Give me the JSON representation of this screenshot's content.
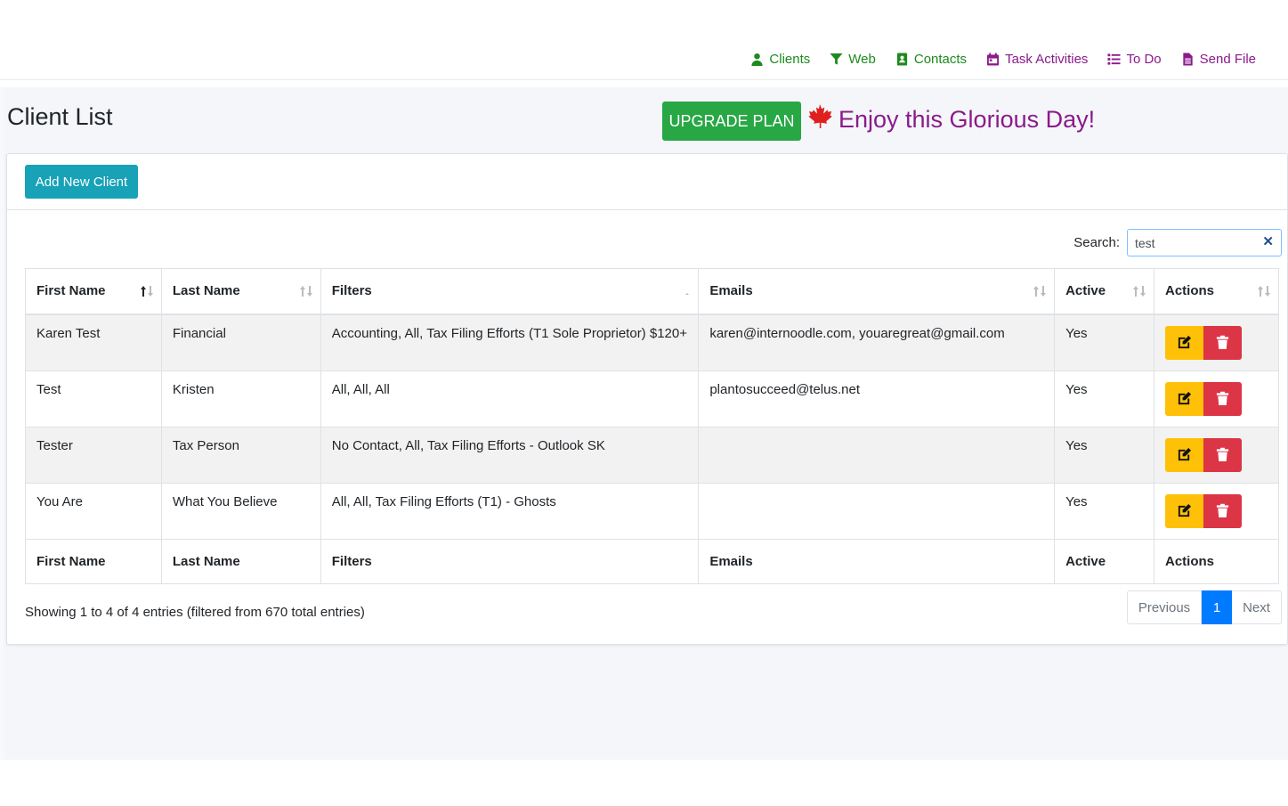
{
  "nav": {
    "items": [
      {
        "label": "Clients",
        "icon": "user-icon",
        "color": "green"
      },
      {
        "label": "Web",
        "icon": "filter-icon",
        "color": "green"
      },
      {
        "label": "Contacts",
        "icon": "address-book-icon",
        "color": "green"
      },
      {
        "label": "Task Activities",
        "icon": "calendar-icon",
        "color": "purple"
      },
      {
        "label": "To Do",
        "icon": "list-icon",
        "color": "purple"
      },
      {
        "label": "Send File",
        "icon": "file-icon",
        "color": "purple"
      }
    ]
  },
  "header": {
    "title": "Client List",
    "upgrade_label": "UPGRADE PLAN",
    "greeting": "Enjoy this Glorious Day!"
  },
  "card": {
    "add_label": "Add New Client",
    "search_label": "Search:",
    "search_value": "test",
    "search_clear": "✕"
  },
  "table": {
    "columns": [
      "First Name",
      "Last Name",
      "Filters",
      "Emails",
      "Active",
      "Actions"
    ],
    "rows": [
      {
        "first": "Karen Test",
        "last": "Financial",
        "filters": "Accounting, All, Tax Filing Efforts (T1 Sole Proprietor) $120+",
        "emails": "karen@internoodle.com, youaregreat@gmail.com",
        "active": "Yes"
      },
      {
        "first": "Test",
        "last": "Kristen",
        "filters": "All, All, All",
        "emails": "plantosucceed@telus.net",
        "active": "Yes"
      },
      {
        "first": "Tester",
        "last": "Tax Person",
        "filters": "No Contact, All, Tax Filing Efforts - Outlook SK",
        "emails": "",
        "active": "Yes"
      },
      {
        "first": "You Are",
        "last": "What You Believe",
        "filters": "All, All, Tax Filing Efforts (T1) - Ghosts",
        "emails": "",
        "active": "Yes"
      }
    ]
  },
  "footer": {
    "info": "Showing 1 to 4 of 4 entries (filtered from 670 total entries)",
    "prev_label": "Previous",
    "page_label": "1",
    "next_label": "Next"
  },
  "colors": {
    "nav_green": "#1e8a1e",
    "nav_purple": "#8b1a8b",
    "upgrade": "#28a745",
    "add_button": "#17a2b8",
    "edit_button": "#ffc107",
    "delete_button": "#dc3545",
    "active_page": "#007bff"
  }
}
